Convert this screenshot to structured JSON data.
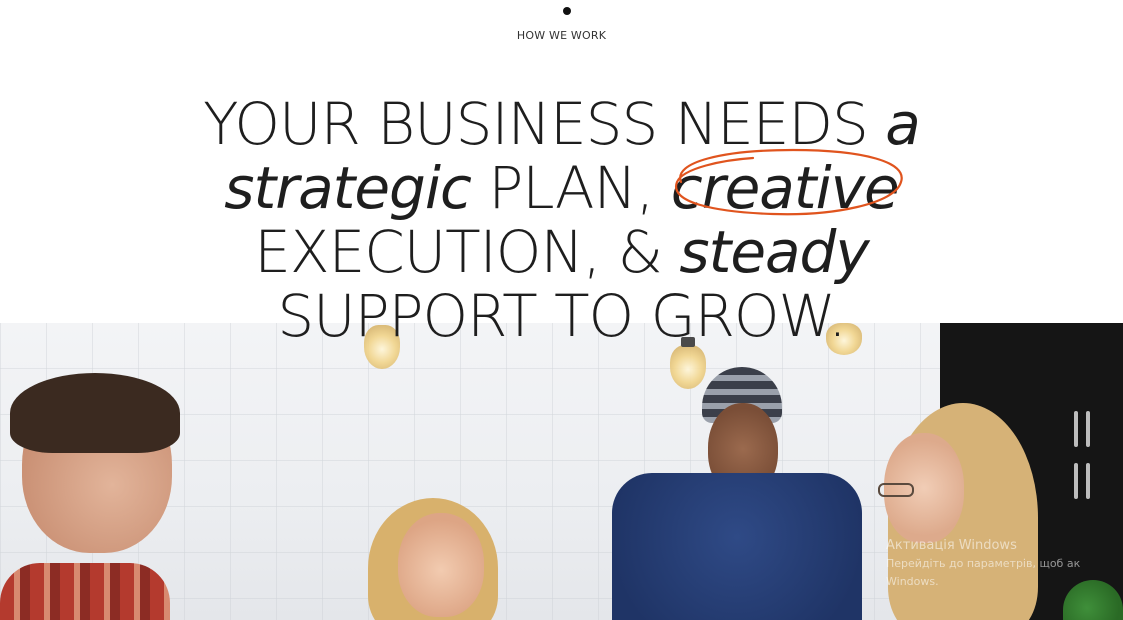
{
  "section": {
    "eyebrow": "HOW WE WORK"
  },
  "headline": {
    "line1_plain": "YOUR BUSINESS NEEDS",
    "line1_italic": "a",
    "line2_italic": "strategic",
    "line2_plain": "PLAN,",
    "line2_circled": "creative",
    "line3_plain": "EXECUTION, &",
    "line3_italic": "steady",
    "line4_plain": "SUPPORT TO GROW."
  },
  "watermark": {
    "title": "Активація Windows",
    "subtitle": "Перейдіть до параметрів, щоб ак",
    "subtitle2": "Windows."
  },
  "colors": {
    "accent_circle": "#e0541e",
    "text": "#1e1e1e",
    "background": "#ffffff"
  },
  "image": {
    "description_icon": "team-photo"
  }
}
